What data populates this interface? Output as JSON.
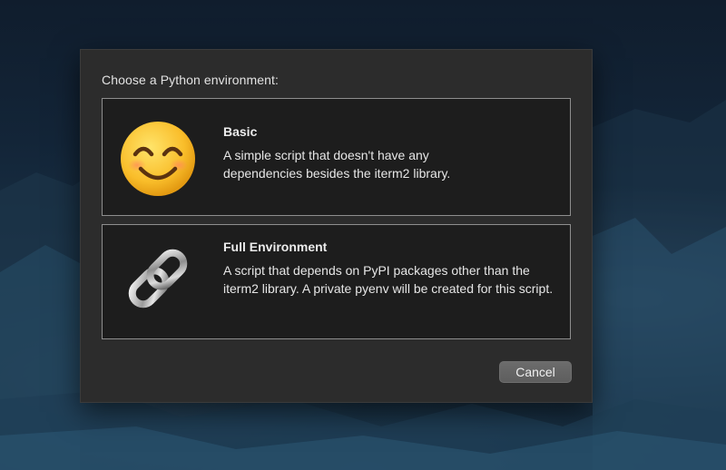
{
  "dialog": {
    "prompt": "Choose a Python environment:",
    "options": [
      {
        "title": "Basic",
        "description": "A simple script that doesn't have any dependencies besides the iterm2 library.",
        "icon": "smiling-face-icon"
      },
      {
        "title": "Full Environment",
        "description": "A script that depends on PyPI packages other than the iterm2 library. A private pyenv will be created for this script.",
        "icon": "chain-link-icon"
      }
    ],
    "cancel_label": "Cancel"
  },
  "colors": {
    "sheet_background": "#2c2c2c",
    "option_background": "#1d1d1d",
    "option_border": "#8e8e8e",
    "button_background": "#666666"
  }
}
